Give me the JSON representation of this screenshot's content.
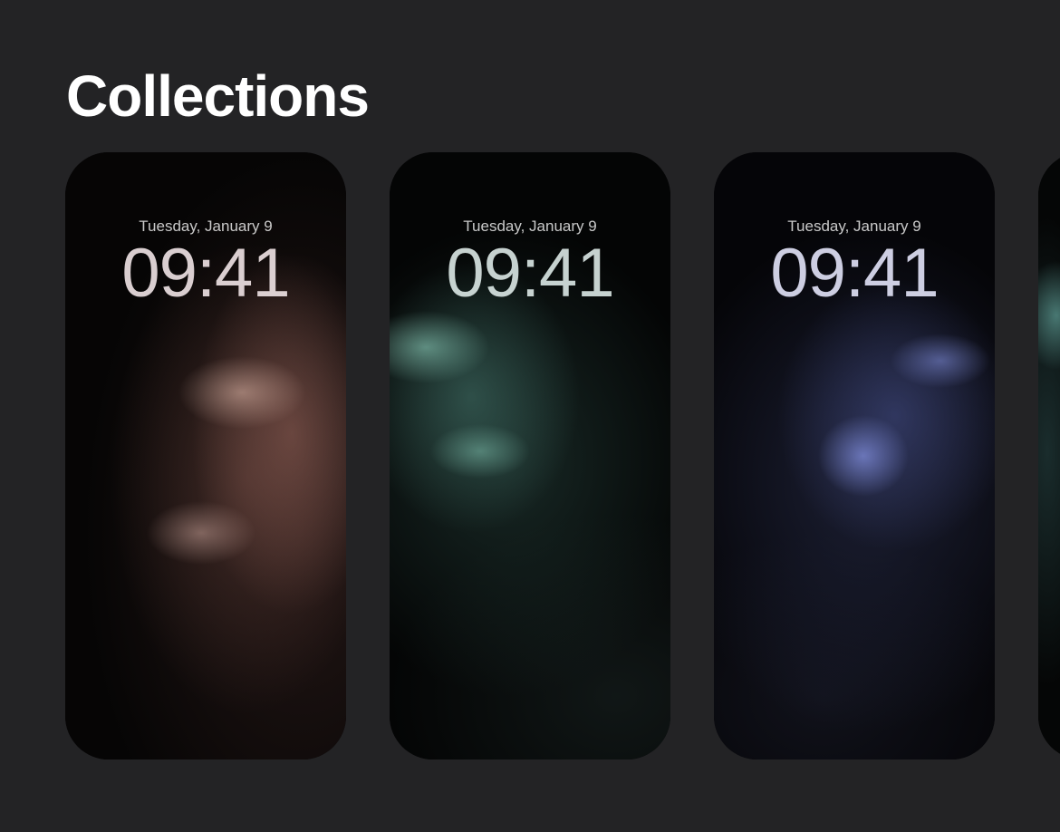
{
  "page": {
    "title": "Collections"
  },
  "collections": [
    {
      "name": "wallpaper-copper",
      "date": "Tuesday, January 9",
      "time": "09:41",
      "accent": "#d9b0a6"
    },
    {
      "name": "wallpaper-green",
      "date": "Tuesday, January 9",
      "time": "09:41",
      "accent": "#8fd6c2"
    },
    {
      "name": "wallpaper-blue",
      "date": "Tuesday, January 9",
      "time": "09:41",
      "accent": "#8e9cf5"
    },
    {
      "name": "wallpaper-partial",
      "date": "",
      "time": "",
      "accent": "#7fc8bc"
    }
  ],
  "colors": {
    "background": "#232325",
    "title": "#ffffff"
  }
}
